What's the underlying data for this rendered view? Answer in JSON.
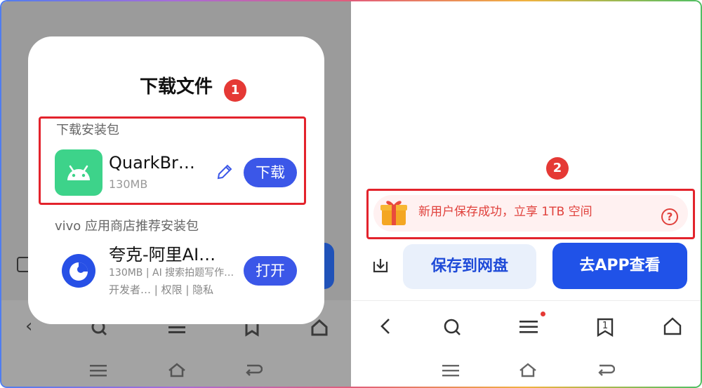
{
  "left": {
    "dialog": {
      "title": "下载文件",
      "marker": "1",
      "install_section_label": "下载安装包",
      "app": {
        "name": "QuarkBr…",
        "size": "130MB",
        "download_label": "下载"
      },
      "store_section_label": "vivo 应用商店推荐安装包",
      "store_app": {
        "name": "夸克-阿里AI…",
        "meta": "130MB | AI 搜索拍题写作…",
        "info": "开发者… | 权限 | 隐私",
        "open_label": "打开"
      }
    }
  },
  "right": {
    "marker": "2",
    "promo": {
      "text": "新用户保存成功，立享 1TB 空间",
      "help": "?"
    },
    "save_label": "保存到网盘",
    "goapp_label": "去APP查看",
    "tab_count": "1"
  },
  "colors": {
    "accent": "#3b57e8",
    "android_green": "#3dd38a",
    "highlight_red": "#e3232c",
    "promo_bg": "#fff1f1"
  },
  "icons": [
    "android-icon",
    "pencil-icon",
    "quark-icon",
    "gift-icon",
    "help-icon",
    "download-icon",
    "back-icon",
    "search-icon",
    "menu-icon",
    "tabs-icon",
    "home-icon"
  ]
}
